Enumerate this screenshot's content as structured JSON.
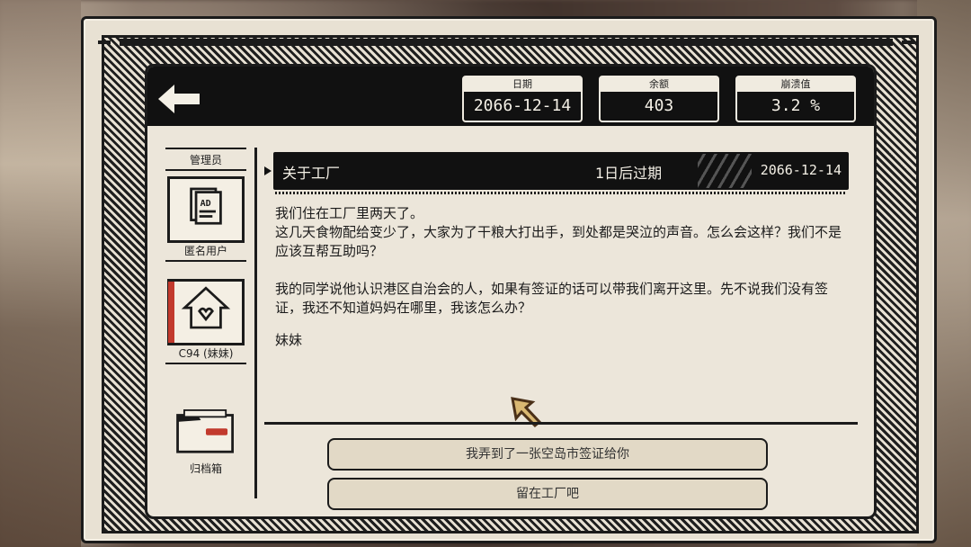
{
  "header": {
    "stats": [
      {
        "label": "日期",
        "value": "2066-12-14"
      },
      {
        "label": "余额",
        "value": "403"
      },
      {
        "label": "崩溃值",
        "value": "3.2 %"
      }
    ]
  },
  "sidebar": {
    "items": [
      {
        "label": "管理员",
        "icon": "admin-icon"
      },
      {
        "label": "匿名用户",
        "icon": "ad-document-icon"
      },
      {
        "label": "C94 (妹妹)",
        "icon": "house-heart-icon"
      },
      {
        "label": "归档箱",
        "icon": "folder-icon"
      }
    ]
  },
  "message": {
    "title": "关于工厂",
    "expiry": "1日后过期",
    "date": "2066-12-14",
    "paragraphs": [
      "我们住在工厂里两天了。\n这几天食物配给变少了，大家为了干粮大打出手，到处都是哭泣的声音。怎么会这样？我们不是应该互帮互助吗？",
      "我的同学说他认识港区自治会的人，如果有签证的话可以带我们离开这里。先不说我们没有签证，我还不知道妈妈在哪里，我该怎么办？"
    ],
    "signature": "妹妹"
  },
  "options": [
    {
      "label": "我弄到了一张空岛市签证给你"
    },
    {
      "label": "留在工厂吧"
    }
  ],
  "colors": {
    "frame": "#1b1b1b",
    "paper": "#ece6da",
    "accent_red": "#c23a2d"
  }
}
